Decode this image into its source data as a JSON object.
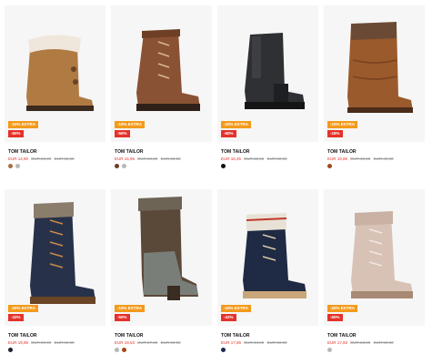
{
  "products": [
    {
      "brand": "TOM TAILOR",
      "extra": "-10% EXTRA",
      "discount": "-50%",
      "price": "EUR 14,90",
      "old_price": "EUR 29,90",
      "orig_price": "EUR 59,90",
      "colors": [
        "#a8713f",
        "#b7b7b7"
      ]
    },
    {
      "brand": "TOM TAILOR",
      "extra": "-10% EXTRA",
      "discount": "-50%",
      "price": "EUR 16,95",
      "old_price": "EUR 29,90",
      "orig_price": "EUR 59,90",
      "colors": [
        "#6b3f24",
        "#b7b7b7"
      ]
    },
    {
      "brand": "TOM TAILOR",
      "extra": "-10% EXTRA",
      "discount": "-60%",
      "price": "EUR 16,45",
      "old_price": "EUR 22,90",
      "orig_price": "EUR 59,90",
      "colors": [
        "#111111"
      ]
    },
    {
      "brand": "TOM TAILOR",
      "extra": "-10% EXTRA",
      "discount": "-18%",
      "price": "EUR 19,95",
      "old_price": "EUR 39,90",
      "orig_price": "EUR 49,90",
      "colors": [
        "#a04a1c"
      ]
    },
    {
      "brand": "TOM TAILOR",
      "extra": "-20% EXTRA",
      "discount": "-42%",
      "price": "EUR 19,95",
      "old_price": "EUR 29,90",
      "orig_price": "EUR 69,90",
      "colors": [
        "#1c2333"
      ]
    },
    {
      "brand": "TOM TAILOR",
      "extra": "-10% EXTRA",
      "discount": "-50%",
      "price": "EUR 19,53",
      "old_price": "EUR 27,90",
      "orig_price": "EUR 69,90",
      "colors": [
        "#b7b7b7",
        "#a04a1c"
      ]
    },
    {
      "brand": "TOM TAILOR",
      "extra": "-10% EXTRA",
      "discount": "-42%",
      "price": "EUR 17,65",
      "old_price": "EUR 34,90",
      "orig_price": "EUR 59,90",
      "colors": [
        "#1c2a55"
      ]
    },
    {
      "brand": "TOM TAILOR",
      "extra": "-20% EXTRA",
      "discount": "-60%",
      "price": "EUR 17,93",
      "old_price": "EUR 23,90",
      "orig_price": "EUR 59,90",
      "colors": [
        "#b7b7b7"
      ]
    }
  ]
}
